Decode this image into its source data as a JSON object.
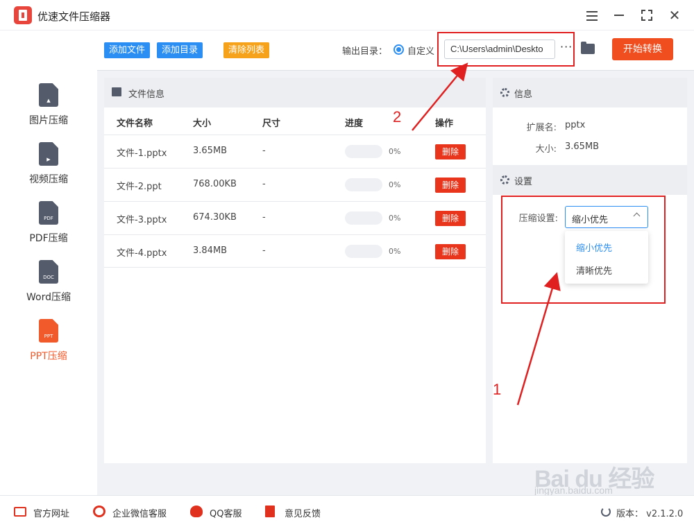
{
  "app": {
    "title": "优速文件压缩器"
  },
  "sidebar": {
    "items": [
      {
        "label": "图片压缩",
        "glyph": "▲",
        "active": false
      },
      {
        "label": "视频压缩",
        "glyph": "▶",
        "active": false
      },
      {
        "label": "PDF压缩",
        "glyph": "PDF",
        "active": false
      },
      {
        "label": "Word压缩",
        "glyph": "DOC",
        "active": false
      },
      {
        "label": "PPT压缩",
        "glyph": "PPT",
        "active": true
      }
    ]
  },
  "toolbar": {
    "add_file": "添加文件",
    "add_folder": "添加目录",
    "clear_list": "清除列表",
    "output_label": "输出目录：",
    "radio_label": "自定义",
    "output_path": "C:\\Users\\admin\\Deskto",
    "more": "···",
    "start": "开始转换"
  },
  "file_panel": {
    "title": "文件信息",
    "columns": [
      "文件名称",
      "大小",
      "尺寸",
      "进度",
      "操作"
    ],
    "rows": [
      {
        "name": "文件-1.pptx",
        "size": "3.65MB",
        "dims": "-",
        "progress": 0,
        "pct": "0%",
        "action": "删除"
      },
      {
        "name": "文件-2.ppt",
        "size": "768.00KB",
        "dims": "-",
        "progress": 0,
        "pct": "0%",
        "action": "删除"
      },
      {
        "name": "文件-3.pptx",
        "size": "674.30KB",
        "dims": "-",
        "progress": 0,
        "pct": "0%",
        "action": "删除"
      },
      {
        "name": "文件-4.pptx",
        "size": "3.84MB",
        "dims": "-",
        "progress": 0,
        "pct": "0%",
        "action": "删除"
      }
    ]
  },
  "info_panel": {
    "title": "信息",
    "ext_key": "扩展名:",
    "ext_val": "pptx",
    "size_key": "大小:",
    "size_val": "3.65MB"
  },
  "settings": {
    "title": "设置",
    "compress_label": "压缩设置:",
    "selected": "缩小优先",
    "options": [
      "缩小优先",
      "清晰优先"
    ]
  },
  "annotations": {
    "num1": "1",
    "num2": "2",
    "color": "#e02020"
  },
  "footer": {
    "items": [
      "官方网址",
      "企业微信客服",
      "QQ客服",
      "意见反馈"
    ],
    "version": "版本：  v2.1.2.0"
  },
  "watermark": {
    "logo": "Bai du 经验",
    "sub": "jingyan.baidu.com"
  },
  "colors": {
    "accent": "#2b8ef3",
    "danger": "#e8351b",
    "start": "#f04e1f",
    "active_side": "#f15a2b",
    "orange_btn": "#f7a21b"
  }
}
